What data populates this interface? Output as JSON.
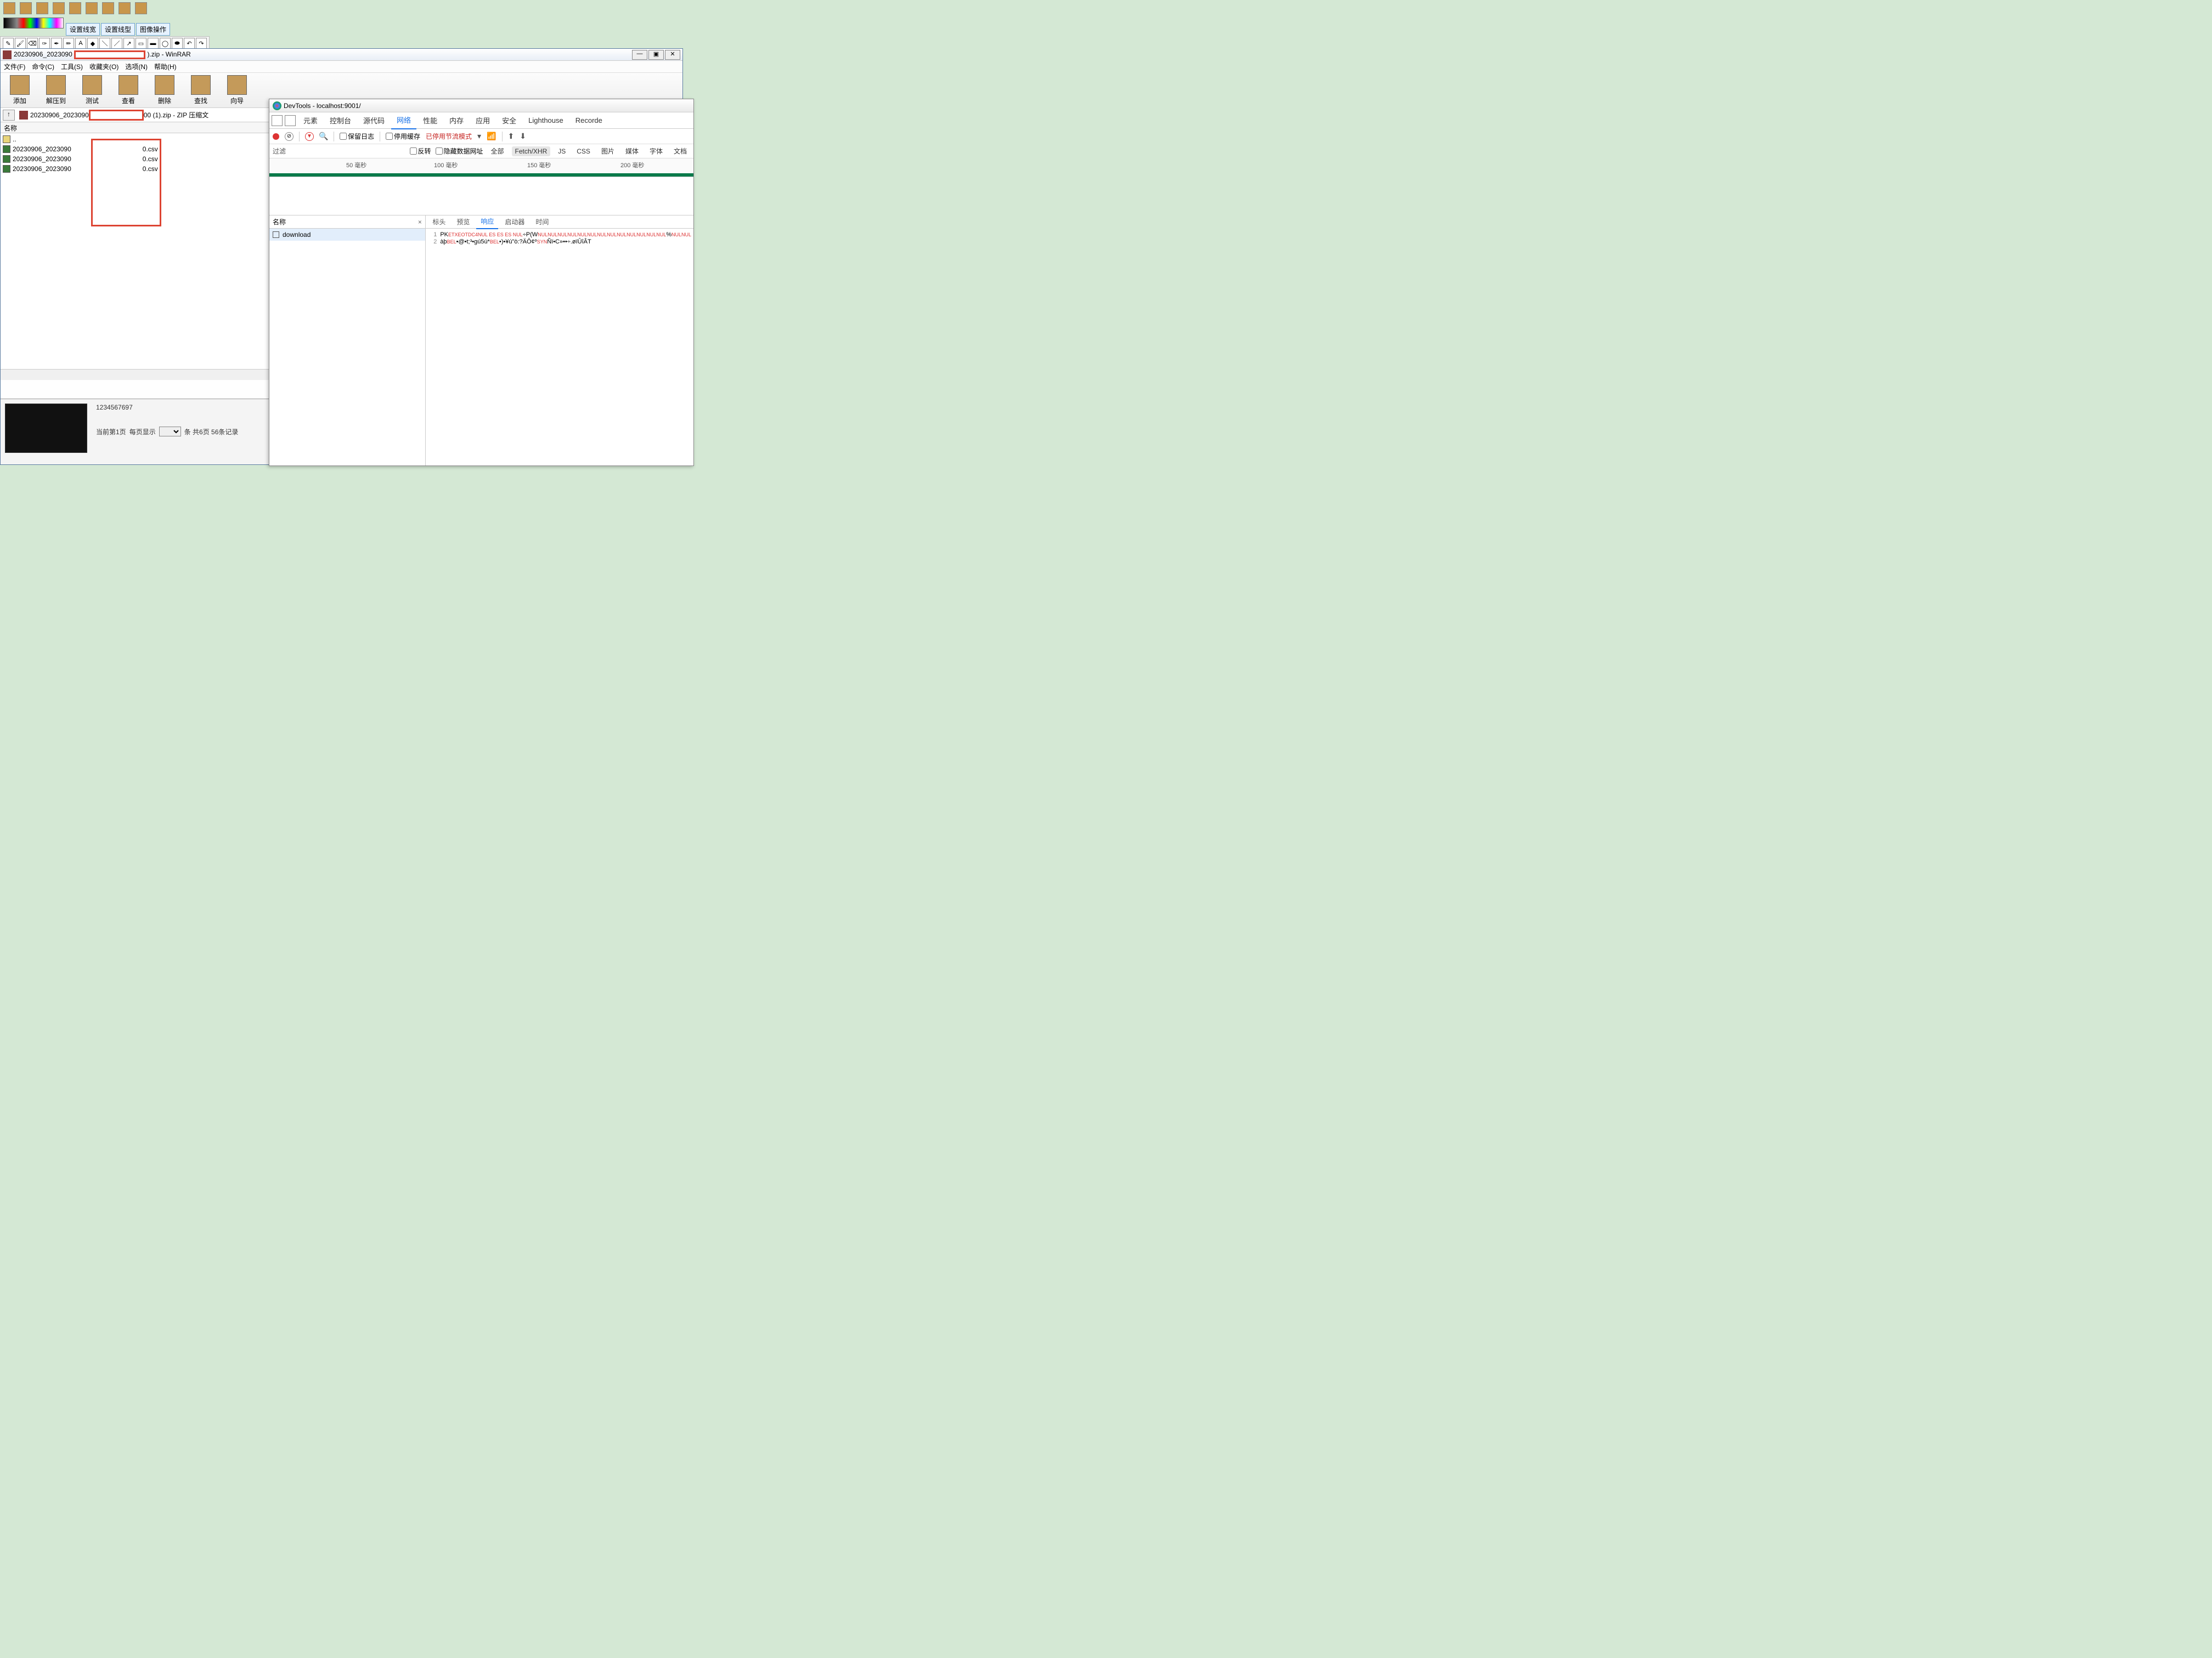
{
  "desktop": {
    "palette_buttons": [
      "设置线宽",
      "设置线型",
      "图像操作"
    ]
  },
  "winrar": {
    "title_prefix": "20230906_2023090",
    "title_suffix": ").zip - WinRAR",
    "menu": {
      "file": "文件(F)",
      "cmd": "命令(C)",
      "tools": "工具(S)",
      "fav": "收藏夹(O)",
      "opt": "选项(N)",
      "help": "帮助(H)"
    },
    "toolbar": {
      "add": "添加",
      "extract": "解压到",
      "test": "测试",
      "view": "查看",
      "delete": "删除",
      "find": "查找",
      "wizard": "向导"
    },
    "path_prefix": "20230906_2023090",
    "path_suffix": "00 (1).zip - ZIP 压缩文",
    "col_name": "名称",
    "files": {
      "up": "..",
      "f1a": "20230906_2023090",
      "f1b": "0.csv",
      "f2a": "20230906_2023090",
      "f2b": "0.csv",
      "f3a": "20230906_2023090",
      "f3b": "0.csv"
    },
    "bottom": {
      "number": "1234567697",
      "pager_a": "当前第1页",
      "pager_b": "每页显示",
      "pager_c": "条 共6页 56条记录"
    }
  },
  "devtools": {
    "title": "DevTools - localhost:9001/",
    "tabs": {
      "elements": "元素",
      "console": "控制台",
      "sources": "源代码",
      "network": "网络",
      "performance": "性能",
      "memory": "内存",
      "application": "应用",
      "security": "安全",
      "lighthouse": "Lighthouse",
      "recorder": "Recorde"
    },
    "subbar": {
      "preserve": "保留日志",
      "disable_cache": "停用缓存",
      "throttling": "已停用节流模式"
    },
    "filter": {
      "label": "过滤",
      "invert": "反转",
      "hide_data": "隐藏数据网址",
      "all": "全部",
      "fetch": "Fetch/XHR",
      "js": "JS",
      "css": "CSS",
      "img": "图片",
      "media": "媒体",
      "font": "字体",
      "doc": "文档"
    },
    "timeline": {
      "t50": "50 毫秒",
      "t100": "100 毫秒",
      "t150": "150 毫秒",
      "t200": "200 毫秒"
    },
    "reqlist": {
      "col_name": "名称",
      "item1": "download"
    },
    "detail_tabs": {
      "headers": "标头",
      "preview": "预览",
      "response": "响应",
      "initiator": "启动器",
      "timing": "时间"
    },
    "response": {
      "l1a": "PK",
      "l1b": "ETXEOTDC4NUL ES ES ES NUL",
      "l1c": "÷P(W",
      "l1d": "NULNULNULNULNULNULNULNULNULNULNULNULNUL",
      "l1e": "%",
      "l1f": "NULNUL",
      "l2a": "àþ",
      "l2b": "BEL",
      "l2c": "•@•t;³•gú5ú*",
      "l2d": "BEL",
      "l2e": "•)•¥ú\"ò:?ÄÔ¢º",
      "l2f": "SYN",
      "l2g": "Ñï•C»••÷.øïÛîÂT"
    }
  }
}
